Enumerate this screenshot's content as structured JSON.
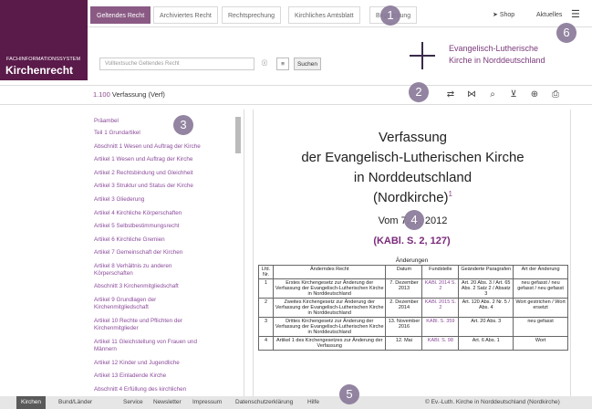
{
  "brand": {
    "subtitle": "FACHINFORMATIONSSYSTEM",
    "title": "Kirchenrecht",
    "color": "#5a1a4a"
  },
  "tabs": [
    "Geltendes Recht",
    "Archiviertes Recht",
    "Rechtsprechung",
    "Kirchliches Amtsblatt",
    "Begründung"
  ],
  "toolbar": {
    "shop": "Shop",
    "aktuelles": "Aktuelles"
  },
  "search": {
    "placeholder": "Volltextsuche Geltendes Recht",
    "button": "Suchen"
  },
  "logo": {
    "line1": "Evangelisch-Lutherische",
    "line2": "Kirche in Norddeutschland"
  },
  "doc": {
    "number": "1.100",
    "title": "Verfassung (Verf)"
  },
  "toc": [
    "Präambel",
    "Teil 1 Grundartikel",
    "Abschnitt 1 Wesen und Auftrag der Kirche",
    "Artikel 1 Wesen und Auftrag der Kirche",
    "Artikel 2 Rechtsbindung und Gleichheit",
    "Artikel 3 Struktur und Status der Kirche",
    "Artikel 3 Gliederung",
    "Artikel 4 Kirchliche Körperschaften",
    "Artikel 5 Selbstbestimmungsrecht",
    "Artikel 6 Kirchliche Gremien",
    "Artikel 7 Gemeinschaft der Kirchen",
    "Artikel 8 Verhältnis zu anderen",
    "Körperschaften",
    "Abschnitt 3 Kirchenmitgliedschaft",
    "Artikel 9 Grundlagen der",
    "Kirchenmitgliedschaft",
    "Artikel 10 Rechte und Pflichten der",
    "Kirchenmitglieder",
    "Artikel 11 Gleichstellung von Frauen und",
    "Männern",
    "Artikel 12 Kinder und Jugendliche",
    "Artikel 13 Einladende Kirche",
    "Abschnitt 4 Erfüllung des kirchlichen"
  ],
  "main": {
    "t1": "Verfassung",
    "t2": "der Evangelisch-Lutherischen Kirche",
    "t3": "in Norddeutschland",
    "t4": "(Nordkirche)",
    "sup": "1",
    "date": "Vom 7. … 2012",
    "kabl": "(KABl. S. 2, 127)",
    "changes": "Änderungen"
  },
  "table": {
    "headers": [
      "Lfd. Nr.",
      "Änderndes Recht",
      "Datum",
      "Fundstelle",
      "Geänderte Paragrafen",
      "Art der Änderung"
    ],
    "rows": [
      [
        "1",
        "Erstes Kirchengesetz zur Änderung der Verfassung der Evangelisch-Lutherischen Kirche in Norddeutschland",
        "7. Dezember 2013",
        "KABl. 2014 S. 2",
        "Art. 20 Abs. 3 / Art. 65 Abs. 2 Satz 2 / Absatz 3",
        "neu gefasst / neu gefasst / neu gefasst"
      ],
      [
        "2",
        "Zweites Kirchengesetz zur Änderung der Verfassung der Evangelisch-Lutherischen Kirche in Norddeutschland",
        "2. Dezember 2014",
        "KABl. 2015 S. 2",
        "Art. 120 Abs. 2 Nr. 5 / Abs. 4",
        "Wort gestrichen / Wort ersetzt"
      ],
      [
        "3",
        "Drittes Kirchengesetz zur Änderung der Verfassung der Evangelisch-Lutherischen Kirche in Norddeutschland",
        "13. November 2016",
        "KABl. S. 359",
        "Art. 20 Abs. 3",
        "neu gefasst"
      ],
      [
        "4",
        "Artikel 1 des Kirchengesetzes zur Änderung der Verfassung",
        "12. Mai",
        "KABl. S. 98",
        "Art. 6 Abs. 1",
        "Wort"
      ]
    ]
  },
  "footer": {
    "kirchen": "Kirchen",
    "bund": "Bund/Länder",
    "service": "Service",
    "newsletter": "Newsletter",
    "impressum": "Impressum",
    "datenschutz": "Datenschutzerklärung",
    "hilfe": "Hilfe",
    "copyright": "© Ev.-Luth. Kirche in Norddeutschland (Nordkirche)"
  },
  "badges": [
    "1",
    "2",
    "3",
    "4",
    "5",
    "6"
  ]
}
